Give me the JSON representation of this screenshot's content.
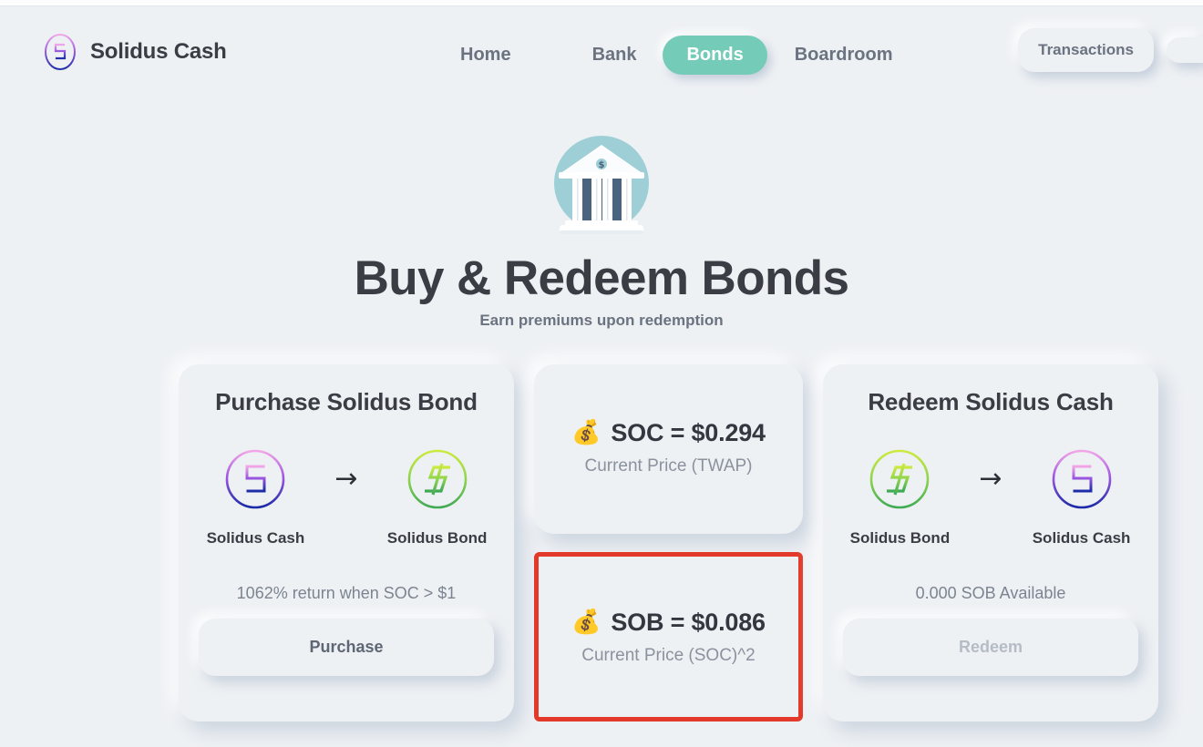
{
  "window": {
    "background_color": "#eef1f4"
  },
  "nav": {
    "brand": {
      "name": "Solidus Cash",
      "logo_icon": "solidus-cash-token-icon"
    },
    "links": [
      {
        "label": "Home",
        "active": false
      },
      {
        "label": "Bank",
        "active": false
      },
      {
        "label": "Bonds",
        "active": true
      },
      {
        "label": "Boardroom",
        "active": false
      }
    ],
    "active_pill_color": "#74ccb8",
    "right_buttons": [
      {
        "label": "Transactions"
      },
      {
        "label": ""
      }
    ]
  },
  "hero": {
    "icon": "bank-building-icon",
    "title": "Buy & Redeem Bonds",
    "subtitle": "Earn premiums upon redemption"
  },
  "purchase_card": {
    "title": "Purchase Solidus Bond",
    "from_token": {
      "label": "Solidus Cash",
      "icon": "soc-token-icon"
    },
    "arrow": "→",
    "to_token": {
      "label": "Solidus Bond",
      "icon": "sob-token-icon"
    },
    "note": "1062% return when SOC > $1",
    "button_label": "Purchase"
  },
  "price_cards": [
    {
      "emoji": "💰",
      "line": "SOC = $0.294",
      "caption": "Current Price (TWAP)",
      "highlighted": false
    },
    {
      "emoji": "💰",
      "line": "SOB = $0.086",
      "caption": "Current Price (SOC)^2",
      "highlighted": true,
      "highlight_color": "#e2392a"
    }
  ],
  "redeem_card": {
    "title": "Redeem Solidus Cash",
    "from_token": {
      "label": "Solidus Bond",
      "icon": "sob-token-icon"
    },
    "arrow": "→",
    "to_token": {
      "label": "Solidus Cash",
      "icon": "soc-token-icon"
    },
    "note": "0.000 SOB Available",
    "button_label": "Redeem",
    "button_disabled": true
  }
}
